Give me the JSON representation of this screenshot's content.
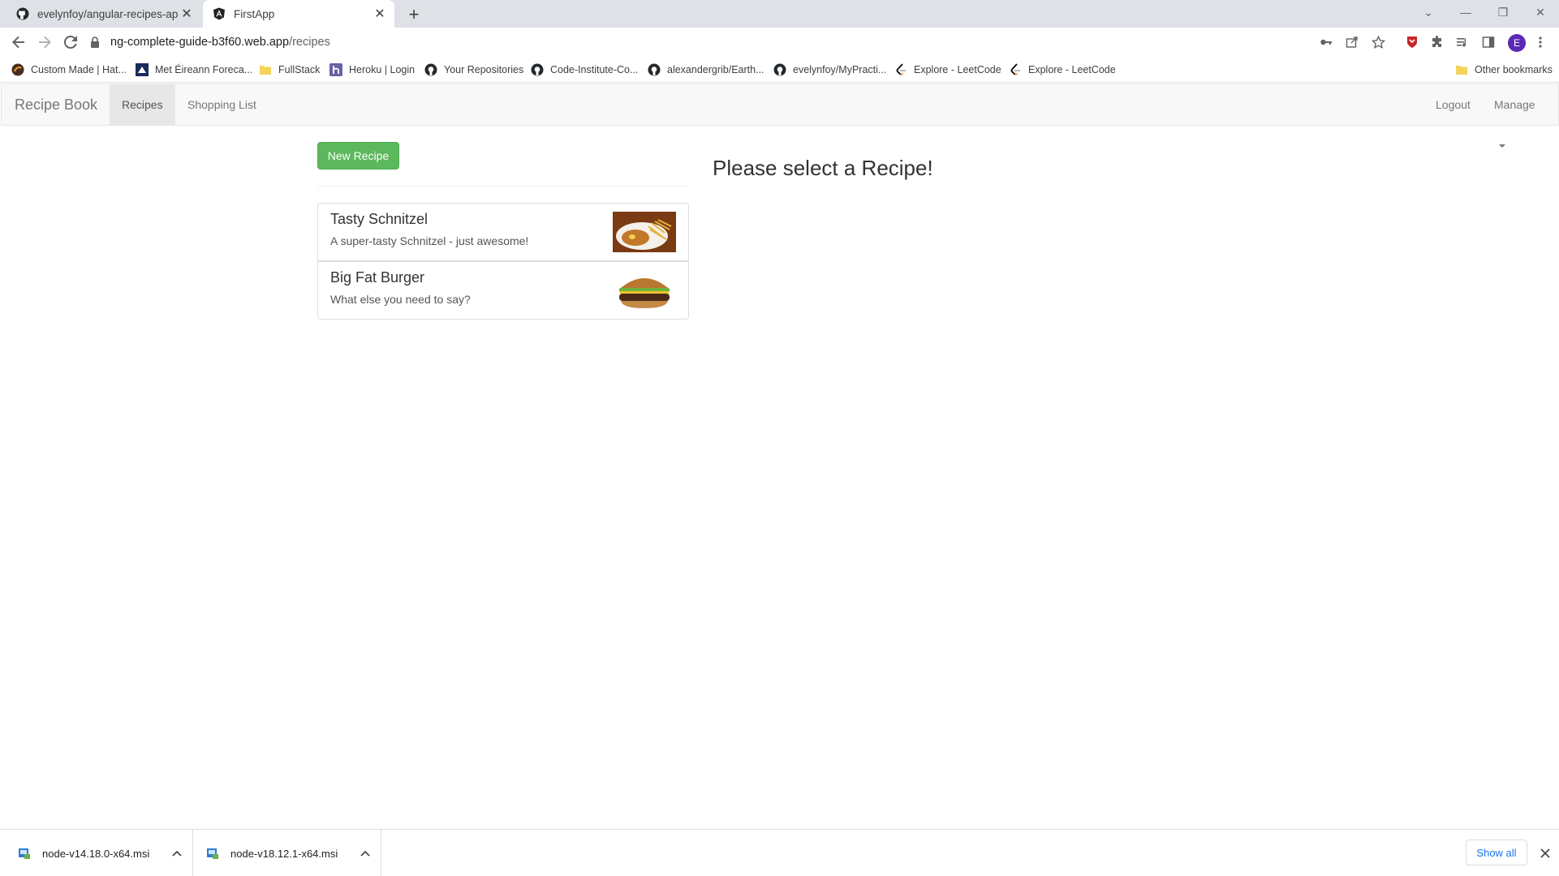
{
  "browser": {
    "tabs": [
      {
        "title": "evelynfoy/angular-recipes-app: T",
        "icon": "github-icon",
        "active": false
      },
      {
        "title": "FirstApp",
        "icon": "angular-icon",
        "active": true
      }
    ],
    "url_host": "ng-complete-guide-b3f60.web.app",
    "url_path": "/recipes",
    "profile_initial": "E",
    "bookmarks": [
      {
        "label": "Custom Made | Hat...",
        "icon": "custom-made-icon"
      },
      {
        "label": "Met Éireann Foreca...",
        "icon": "met-eireann-icon"
      },
      {
        "label": "FullStack",
        "icon": "folder-icon"
      },
      {
        "label": "Heroku | Login",
        "icon": "heroku-icon"
      },
      {
        "label": "Your Repositories",
        "icon": "github-icon"
      },
      {
        "label": "Code-Institute-Co...",
        "icon": "github-icon"
      },
      {
        "label": "alexandergrib/Earth...",
        "icon": "github-icon"
      },
      {
        "label": "evelynfoy/MyPracti...",
        "icon": "github-icon"
      },
      {
        "label": "Explore - LeetCode",
        "icon": "leetcode-icon"
      },
      {
        "label": "Explore - LeetCode",
        "icon": "leetcode-icon"
      }
    ],
    "other_bookmarks": "Other bookmarks"
  },
  "app": {
    "brand": "Recipe Book",
    "nav": {
      "recipes": "Recipes",
      "shopping_list": "Shopping List",
      "logout": "Logout",
      "manage": "Manage"
    },
    "active_nav": "Recipes",
    "new_recipe_label": "New Recipe",
    "recipes": [
      {
        "name": "Tasty Schnitzel",
        "description": "A super-tasty Schnitzel - just awesome!"
      },
      {
        "name": "Big Fat Burger",
        "description": "What else you need to say?"
      }
    ],
    "select_message": "Please select a Recipe!",
    "colors": {
      "success": "#5cb85c",
      "navbar_bg": "#f8f8f8",
      "active_nav_bg": "#e7e7e7"
    }
  },
  "downloads": {
    "items": [
      {
        "filename": "node-v14.18.0-x64.msi"
      },
      {
        "filename": "node-v18.12.1-x64.msi"
      }
    ],
    "show_all": "Show all"
  }
}
